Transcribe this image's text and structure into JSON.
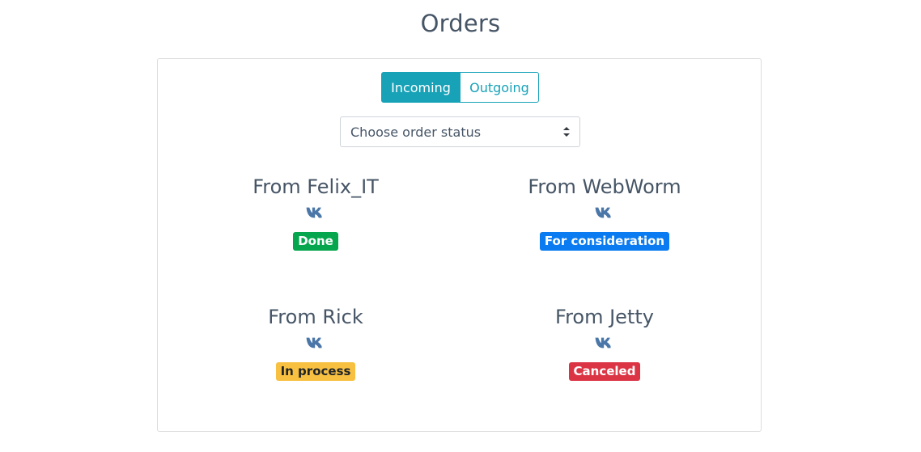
{
  "page": {
    "title": "Orders"
  },
  "tabs": {
    "incoming_label": "Incoming",
    "outgoing_label": "Outgoing",
    "active": "Incoming"
  },
  "status_select": {
    "selected": "Choose order status"
  },
  "orders": [
    {
      "title": "From Felix_IT",
      "icon": "vk-icon",
      "status": "Done",
      "status_color": "#05a64e"
    },
    {
      "title": "From WebWorm",
      "icon": "vk-icon",
      "status": "For consideration",
      "status_color": "#0a7bf0"
    },
    {
      "title": "From Rick",
      "icon": "vk-icon",
      "status": "In process",
      "status_color": "#f7c040"
    },
    {
      "title": "From Jetty",
      "icon": "vk-icon",
      "status": "Canceled",
      "status_color": "#db3545"
    }
  ],
  "colors": {
    "accent": "#17a2b8",
    "vk_icon": "#4a76a8",
    "text": "#465566"
  }
}
